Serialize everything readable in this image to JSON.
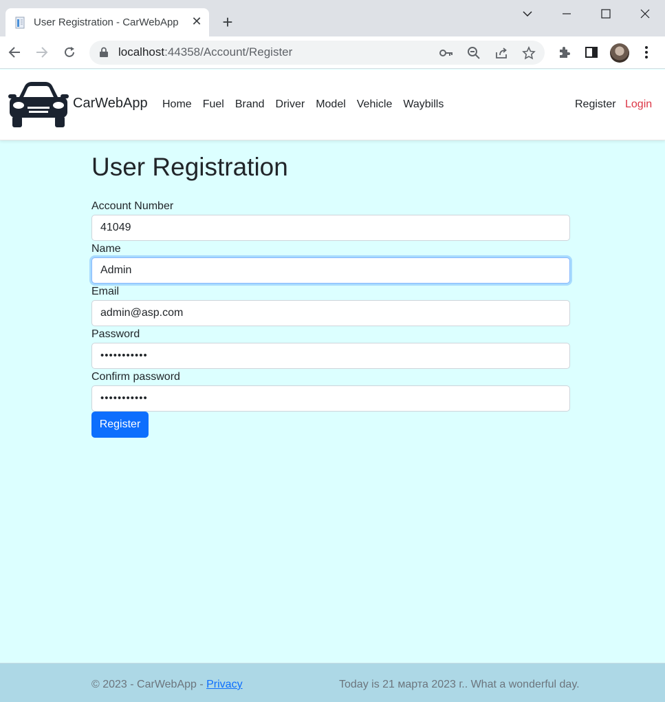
{
  "browser": {
    "tab_title": "User Registration - CarWebApp",
    "url_host": "localhost",
    "url_path": ":44358/Account/Register"
  },
  "site": {
    "brand": "CarWebApp",
    "nav": [
      "Home",
      "Fuel",
      "Brand",
      "Driver",
      "Model",
      "Vehicle",
      "Waybills"
    ],
    "register_link": "Register",
    "login_link": "Login",
    "login_color": "#dc3545"
  },
  "form": {
    "title": "User Registration",
    "account_number_label": "Account Number",
    "account_number_value": "41049",
    "name_label": "Name",
    "name_value": "Admin",
    "email_label": "Email",
    "email_value": "admin@asp.com",
    "password_label": "Password",
    "password_value": "•••••••••••",
    "confirm_label": "Confirm password",
    "confirm_value": "•••••••••••",
    "submit_label": "Register"
  },
  "footer": {
    "copyright": "© 2023 - CarWebApp - ",
    "privacy": "Privacy",
    "date_text": "Today is 21 марта 2023 г.. What a wonderful day."
  },
  "colors": {
    "page_bg": "#dcffff",
    "footer_bg": "#add8e6",
    "primary": "#0d6efd"
  }
}
